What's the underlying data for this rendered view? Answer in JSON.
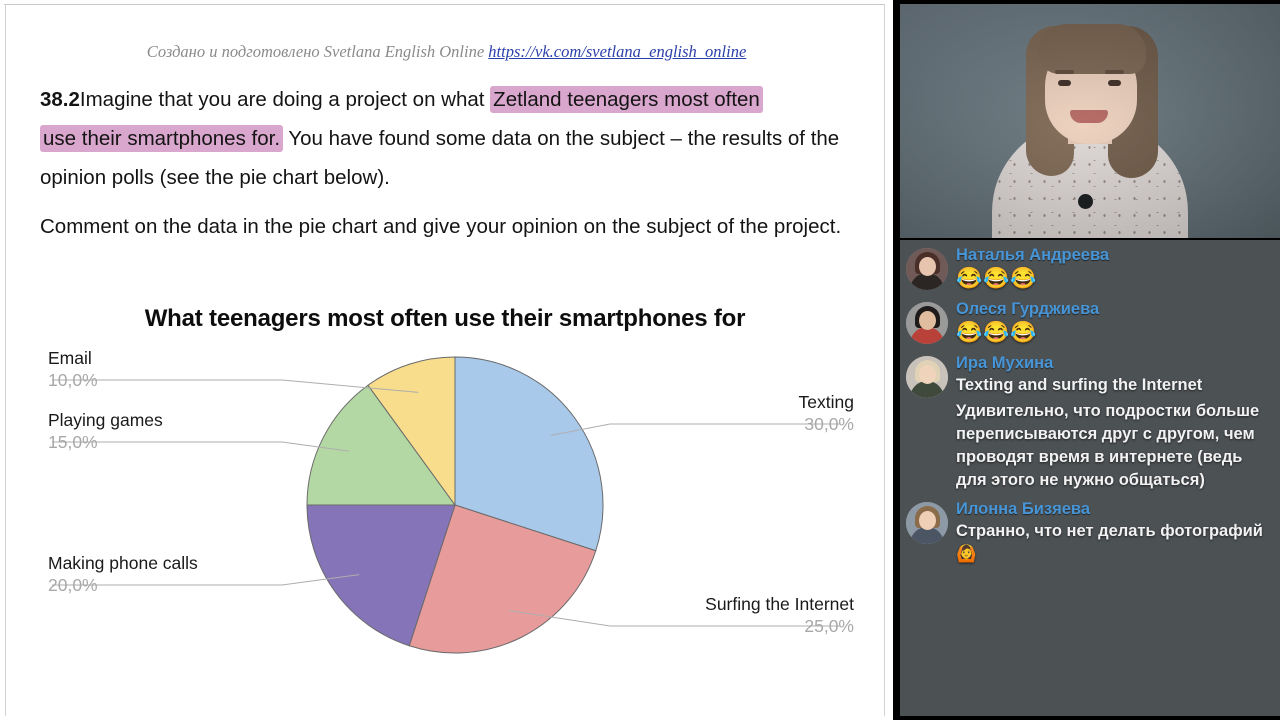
{
  "document": {
    "byline": {
      "prefix": "Создано и подготовлено Svetlana English Online",
      "link": "https://vk.com/svetlana_english_online"
    },
    "task": {
      "number": "38.2",
      "line1_pre": "Imagine that you are doing a project on what ",
      "highlight1": "Zetland teenagers most often",
      "highlight2": "use their smartphones for.",
      "line2_post": " You have found some data on the subject – the results of the opinion polls (see the pie chart below).",
      "paragraph2": "Comment on the data in the pie chart and give your opinion on the subject of the project.",
      "highlight_color": "#d9a6cd"
    }
  },
  "chart_data": {
    "type": "pie",
    "title": "What teenagers most often use their smartphones for",
    "xlabel": "",
    "ylabel": "",
    "legend_position": "callout-labels",
    "categories": [
      "Texting",
      "Surfing the Internet",
      "Making phone calls",
      "Playing games",
      "Email"
    ],
    "values": [
      30.0,
      25.0,
      20.0,
      15.0,
      10.0
    ],
    "value_labels": [
      "30,0%",
      "25,0%",
      "20,0%",
      "15,0%",
      "10,0%"
    ],
    "colors": [
      "#a8c9ea",
      "#e89b9b",
      "#8574b8",
      "#b3d8a4",
      "#f7dd8c"
    ],
    "slices": [
      {
        "label": "Texting",
        "value": 30.0,
        "display": "30,0%",
        "color": "#a8c9ea",
        "side": "right"
      },
      {
        "label": "Surfing the Internet",
        "value": 25.0,
        "display": "25,0%",
        "color": "#e89b9b",
        "side": "right"
      },
      {
        "label": "Making phone calls",
        "value": 20.0,
        "display": "20,0%",
        "color": "#8574b8",
        "side": "left"
      },
      {
        "label": "Playing games",
        "value": 15.0,
        "display": "15,0%",
        "color": "#b3d8a4",
        "side": "left"
      },
      {
        "label": "Email",
        "value": 10.0,
        "display": "10,0%",
        "color": "#f7dd8c",
        "side": "left"
      }
    ]
  },
  "video": {
    "label": "presenter-video"
  },
  "chat": {
    "messages": [
      {
        "name": "Наталья Андреева",
        "text": "😂😂😂",
        "is_emoji": true,
        "avatar": {
          "bg": "#6f5a58",
          "hair": "#4a2e28",
          "skin": "#e6c4ae",
          "body": "#2b2623"
        }
      },
      {
        "name": "Олеся Гурджиева",
        "text": "😂😂😂",
        "is_emoji": true,
        "avatar": {
          "bg": "#9a9a9a",
          "hair": "#1e1b1a",
          "skin": "#e0bd9e",
          "body": "#b8423a"
        }
      },
      {
        "name": "Ира Мухина",
        "text": "Texting and surfing the Internet",
        "is_emoji": false,
        "avatar": {
          "bg": "#c9c2bb",
          "hair": "#e0d2b4",
          "skin": "#f0d3bb",
          "body": "#3f4a3c"
        }
      },
      {
        "name": "",
        "text": "Удивительно, что подростки больше переписываются друг с другом, чем проводят время в интернете (ведь для этого не нужно общаться)",
        "is_emoji": false,
        "continuation": true
      },
      {
        "name": "Илонна Бизяева",
        "text": "Странно, что нет делать фотографий 🙆",
        "is_emoji": false,
        "avatar": {
          "bg": "#8d9aa6",
          "hair": "#8a6b4a",
          "skin": "#efd0b6",
          "body": "#4b5563"
        }
      }
    ],
    "name_color": "#4795d6",
    "background": "#4c5154"
  }
}
